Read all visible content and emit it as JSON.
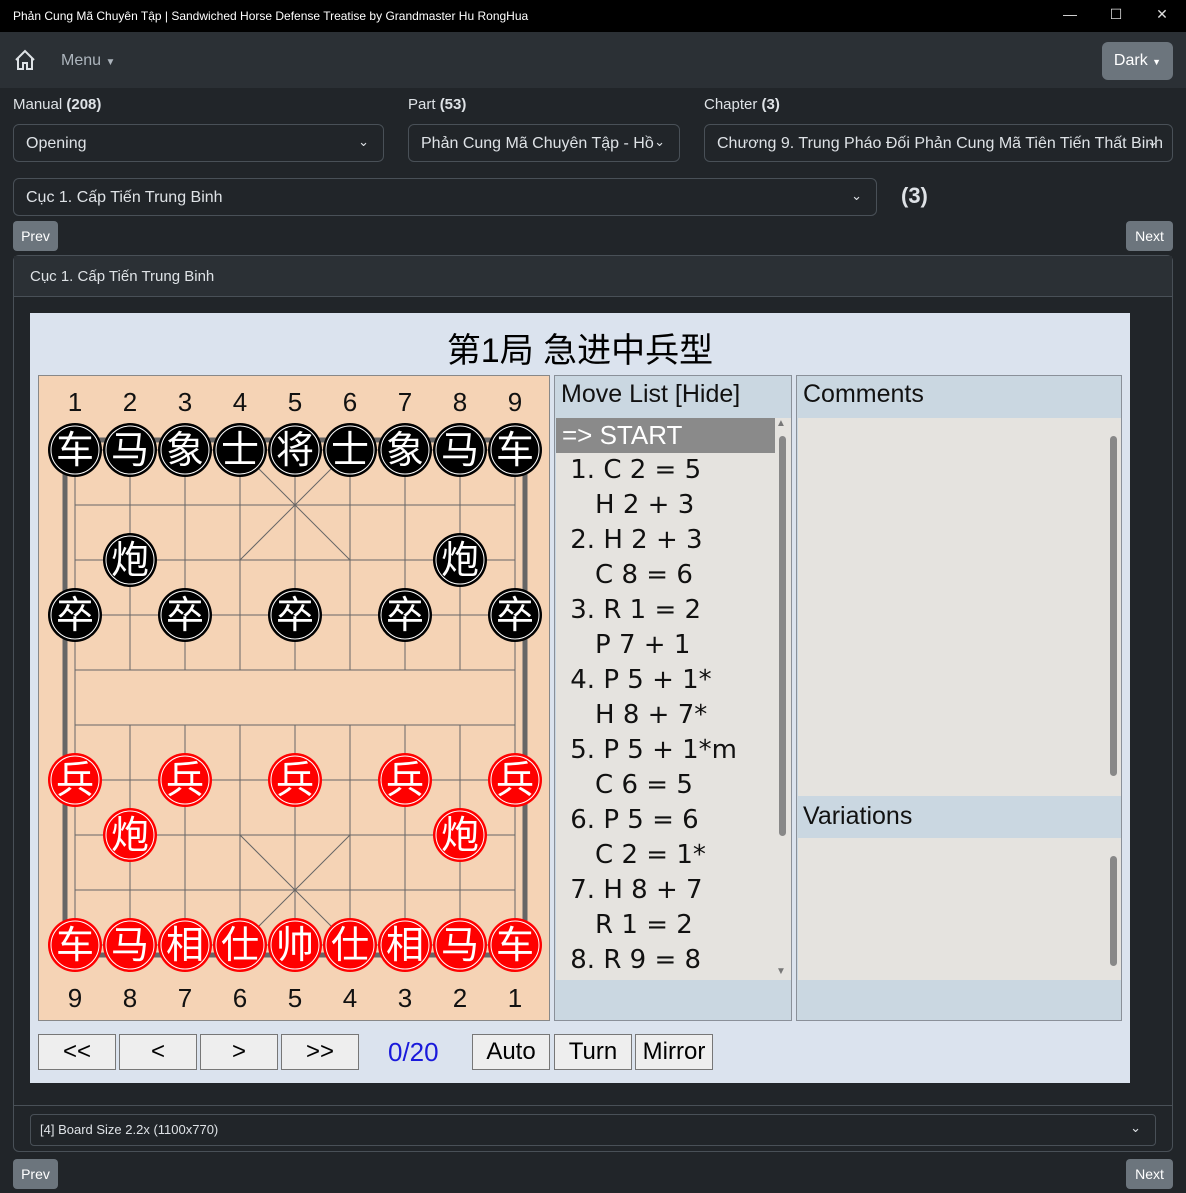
{
  "window": {
    "title": "Phản Cung Mã Chuyên Tập | Sandwiched Horse Defense Treatise by Grandmaster Hu RongHua",
    "minimize": "—",
    "maximize": "☐",
    "close": "✕"
  },
  "nav": {
    "menu": "Menu",
    "theme": "Dark"
  },
  "selectors": {
    "manual": {
      "label": "Manual",
      "count": "(208)",
      "value": "Opening"
    },
    "part": {
      "label": "Part",
      "count": "(53)",
      "value": "Phản Cung Mã Chuyên Tập - Hồ"
    },
    "chapter": {
      "label": "Chapter",
      "count": "(3)",
      "value": "Chương 9. Trung Pháo Đối Phản Cung Mã Tiên Tiến Thất Binh"
    },
    "game": {
      "value": "Cục 1. Cấp Tiến Trung Binh",
      "count": "(3)"
    }
  },
  "buttons": {
    "prev": "Prev",
    "next": "Next"
  },
  "card": {
    "title": "Cục 1. Cấp Tiến Trung Binh"
  },
  "board": {
    "title": "第1局 急进中兵型",
    "top_files": [
      "1",
      "2",
      "3",
      "4",
      "5",
      "6",
      "7",
      "8",
      "9"
    ],
    "bottom_files": [
      "9",
      "8",
      "7",
      "6",
      "5",
      "4",
      "3",
      "2",
      "1"
    ],
    "colors": {
      "board": "#f5d3b5",
      "black": "#000000",
      "red": "#ff0000",
      "line": "#666666"
    },
    "pieces": [
      {
        "c": "车",
        "side": "black",
        "col": 0,
        "row": 0
      },
      {
        "c": "马",
        "side": "black",
        "col": 1,
        "row": 0
      },
      {
        "c": "象",
        "side": "black",
        "col": 2,
        "row": 0
      },
      {
        "c": "士",
        "side": "black",
        "col": 3,
        "row": 0
      },
      {
        "c": "将",
        "side": "black",
        "col": 4,
        "row": 0
      },
      {
        "c": "士",
        "side": "black",
        "col": 5,
        "row": 0
      },
      {
        "c": "象",
        "side": "black",
        "col": 6,
        "row": 0
      },
      {
        "c": "马",
        "side": "black",
        "col": 7,
        "row": 0
      },
      {
        "c": "车",
        "side": "black",
        "col": 8,
        "row": 0
      },
      {
        "c": "炮",
        "side": "black",
        "col": 1,
        "row": 2
      },
      {
        "c": "炮",
        "side": "black",
        "col": 7,
        "row": 2
      },
      {
        "c": "卒",
        "side": "black",
        "col": 0,
        "row": 3
      },
      {
        "c": "卒",
        "side": "black",
        "col": 2,
        "row": 3
      },
      {
        "c": "卒",
        "side": "black",
        "col": 4,
        "row": 3
      },
      {
        "c": "卒",
        "side": "black",
        "col": 6,
        "row": 3
      },
      {
        "c": "卒",
        "side": "black",
        "col": 8,
        "row": 3
      },
      {
        "c": "兵",
        "side": "red",
        "col": 0,
        "row": 6
      },
      {
        "c": "兵",
        "side": "red",
        "col": 2,
        "row": 6
      },
      {
        "c": "兵",
        "side": "red",
        "col": 4,
        "row": 6
      },
      {
        "c": "兵",
        "side": "red",
        "col": 6,
        "row": 6
      },
      {
        "c": "兵",
        "side": "red",
        "col": 8,
        "row": 6
      },
      {
        "c": "炮",
        "side": "red",
        "col": 1,
        "row": 7
      },
      {
        "c": "炮",
        "side": "red",
        "col": 7,
        "row": 7
      },
      {
        "c": "车",
        "side": "red",
        "col": 0,
        "row": 9
      },
      {
        "c": "马",
        "side": "red",
        "col": 1,
        "row": 9
      },
      {
        "c": "相",
        "side": "red",
        "col": 2,
        "row": 9
      },
      {
        "c": "仕",
        "side": "red",
        "col": 3,
        "row": 9
      },
      {
        "c": "帅",
        "side": "red",
        "col": 4,
        "row": 9
      },
      {
        "c": "仕",
        "side": "red",
        "col": 5,
        "row": 9
      },
      {
        "c": "相",
        "side": "red",
        "col": 6,
        "row": 9
      },
      {
        "c": "马",
        "side": "red",
        "col": 7,
        "row": 9
      },
      {
        "c": "车",
        "side": "red",
        "col": 8,
        "row": 9
      }
    ]
  },
  "movelist": {
    "header": "Move List [Hide]",
    "moves": [
      "=> START",
      " 1. C 2 = 5",
      "    H 2 + 3",
      " 2. H 2 + 3",
      "    C 8 = 6",
      " 3. R 1 = 2",
      "    P 7 + 1",
      " 4. P 5 + 1*",
      "    H 8 + 7*",
      " 5. P 5 + 1*m",
      "    C 6 = 5",
      " 6. P 5 = 6",
      "    C 2 = 1*",
      " 7. H 8 + 7",
      "    R 1 = 2",
      " 8. R 9 = 8"
    ]
  },
  "comments": {
    "header": "Comments"
  },
  "variations": {
    "header": "Variations"
  },
  "controls": {
    "first": "<<",
    "prev": "<",
    "next": ">",
    "last": ">>",
    "counter": "0/20",
    "auto": "Auto",
    "turn": "Turn",
    "mirror": "Mirror"
  },
  "boardsize": {
    "value": "[4] Board Size 2.2x (1100x770)"
  }
}
